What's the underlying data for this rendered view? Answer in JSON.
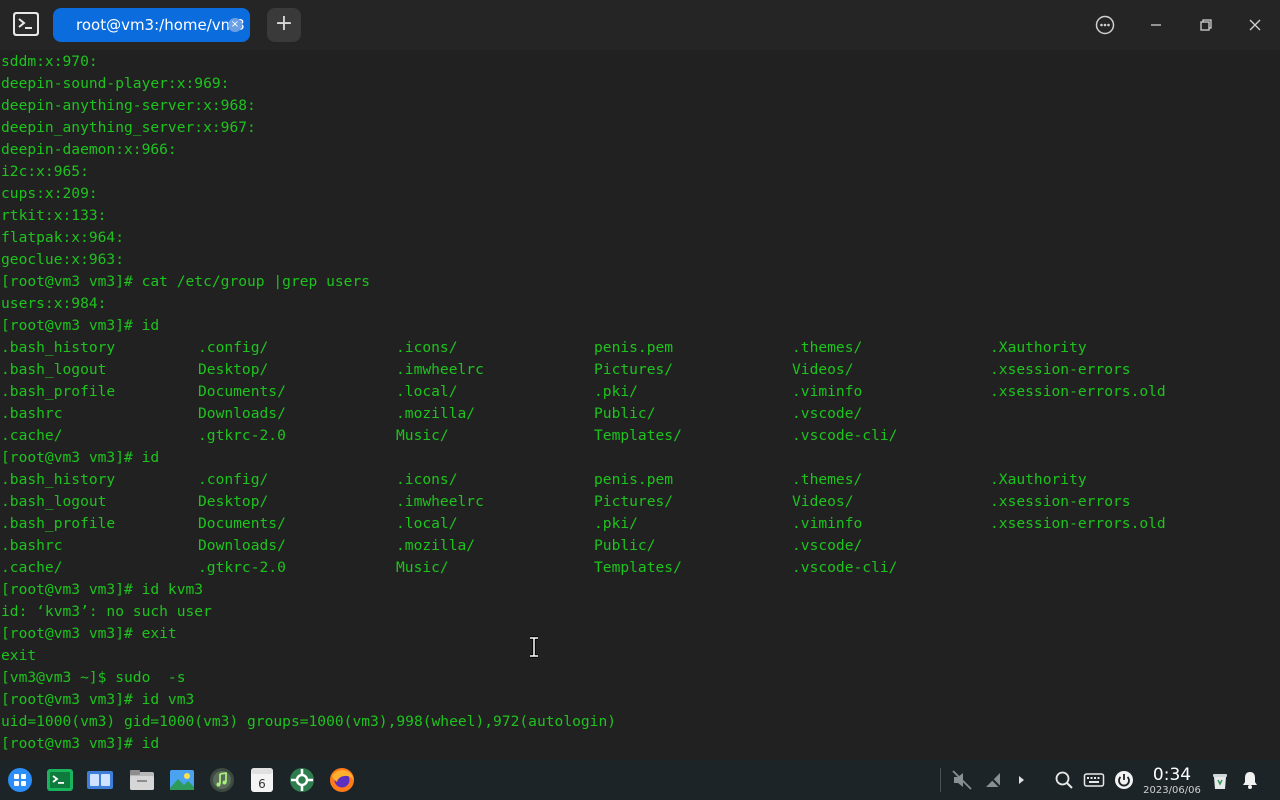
{
  "window": {
    "tab_title": "root@vm3:/home/vm3",
    "tab_close": "×",
    "add_tab": "+"
  },
  "terminal": {
    "lines": [
      "sddm:x:970:",
      "deepin-sound-player:x:969:",
      "deepin-anything-server:x:968:",
      "deepin_anything_server:x:967:",
      "deepin-daemon:x:966:",
      "i2c:x:965:",
      "cups:x:209:",
      "rtkit:x:133:",
      "flatpak:x:964:",
      "geoclue:x:963:",
      "[root@vm3 vm3]# cat /etc/group |grep users",
      "users:x:984:",
      "[root@vm3 vm3]# id"
    ],
    "listing1": [
      [
        ".bash_history",
        ".config/",
        ".icons/",
        "penis.pem",
        ".themes/",
        ".Xauthority"
      ],
      [
        ".bash_logout",
        "Desktop/",
        ".imwheelrc",
        "Pictures/",
        "Videos/",
        ".xsession-errors"
      ],
      [
        ".bash_profile",
        "Documents/",
        ".local/",
        ".pki/",
        ".viminfo",
        ".xsession-errors.old"
      ],
      [
        ".bashrc",
        "Downloads/",
        ".mozilla/",
        "Public/",
        ".vscode/",
        ""
      ],
      [
        ".cache/",
        ".gtkrc-2.0",
        "Music/",
        "Templates/",
        ".vscode-cli/",
        ""
      ]
    ],
    "mid_line": "[root@vm3 vm3]# id",
    "listing2": [
      [
        ".bash_history",
        ".config/",
        ".icons/",
        "penis.pem",
        ".themes/",
        ".Xauthority"
      ],
      [
        ".bash_logout",
        "Desktop/",
        ".imwheelrc",
        "Pictures/",
        "Videos/",
        ".xsession-errors"
      ],
      [
        ".bash_profile",
        "Documents/",
        ".local/",
        ".pki/",
        ".viminfo",
        ".xsession-errors.old"
      ],
      [
        ".bashrc",
        "Downloads/",
        ".mozilla/",
        "Public/",
        ".vscode/",
        ""
      ],
      [
        ".cache/",
        ".gtkrc-2.0",
        "Music/",
        "Templates/",
        ".vscode-cli/",
        ""
      ]
    ],
    "tail_lines": [
      "[root@vm3 vm3]# id kvm3",
      "id: ‘kvm3’: no such user",
      "[root@vm3 vm3]# exit",
      "exit",
      "[vm3@vm3 ~]$ sudo  -s",
      "[root@vm3 vm3]# id vm3",
      "uid=1000(vm3) gid=1000(vm3) groups=1000(vm3),998(wheel),972(autologin)",
      "[root@vm3 vm3]# id"
    ]
  },
  "taskbar": {
    "calendar_day": "6",
    "clock_time": "0:34",
    "clock_date": "2023/06/06"
  },
  "colors": {
    "terminal_text": "#1ec31e",
    "terminal_bg": "#212121",
    "tab_active": "#0b6cde"
  }
}
